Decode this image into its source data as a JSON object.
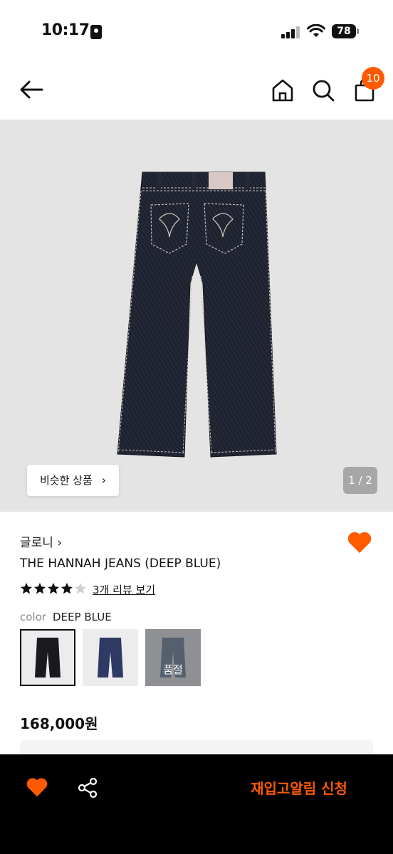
{
  "status_bar": {
    "time": "10:17",
    "battery": "78"
  },
  "header": {
    "cart_count": "10",
    "icons": [
      "back-arrow-icon",
      "home-icon",
      "search-icon",
      "shopping-bag-icon"
    ]
  },
  "gallery": {
    "similar_label": "비슷한 상품",
    "similar_chevron": "›",
    "counter": "1 / 2"
  },
  "product": {
    "brand": "글로니 ›",
    "name": "THE HANNAH JEANS (DEEP BLUE)",
    "rating": 4,
    "rating_max": 5,
    "review_link": "3개 리뷰 보기",
    "color_label": "color",
    "color_value": "DEEP BLUE",
    "swatches": [
      {
        "state": "selected"
      },
      {
        "state": "available"
      },
      {
        "state": "soldout",
        "label": "품절"
      }
    ],
    "price": "168,000원"
  },
  "bottom_bar": {
    "restock_label": "재입고알림 신청"
  },
  "colors": {
    "accent": "#ff5a00",
    "image_bg": "#e4e4e5",
    "bottom_bg": "#000000"
  }
}
